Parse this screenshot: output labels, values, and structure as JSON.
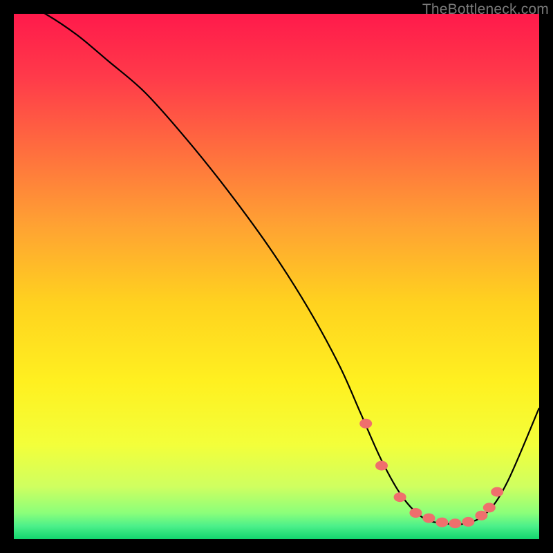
{
  "watermark": "TheBottleneck.com",
  "chart_data": {
    "type": "line",
    "title": "",
    "xlabel": "",
    "ylabel": "",
    "xlim": [
      0,
      100
    ],
    "ylim": [
      0,
      100
    ],
    "grid": false,
    "background_gradient": {
      "stops": [
        {
          "offset": 0.0,
          "color": "#ff1a4b"
        },
        {
          "offset": 0.12,
          "color": "#ff3a4a"
        },
        {
          "offset": 0.25,
          "color": "#ff6a3f"
        },
        {
          "offset": 0.4,
          "color": "#ffa133"
        },
        {
          "offset": 0.55,
          "color": "#ffd21f"
        },
        {
          "offset": 0.7,
          "color": "#fff020"
        },
        {
          "offset": 0.82,
          "color": "#f3ff3a"
        },
        {
          "offset": 0.9,
          "color": "#cfff60"
        },
        {
          "offset": 0.95,
          "color": "#8bff7a"
        },
        {
          "offset": 0.975,
          "color": "#4cf08a"
        },
        {
          "offset": 1.0,
          "color": "#12d66e"
        }
      ]
    },
    "series": [
      {
        "name": "bottleneck-curve",
        "color": "#000000",
        "x": [
          0,
          6,
          12,
          18,
          25,
          33,
          41,
          49,
          56,
          62,
          66,
          70,
          74,
          78,
          82,
          86,
          90,
          94,
          100
        ],
        "values": [
          103,
          100,
          96,
          91,
          85,
          76,
          66,
          55,
          44,
          33,
          24,
          15,
          8,
          4,
          3,
          3,
          5,
          11,
          25
        ]
      }
    ],
    "markers": {
      "name": "highlight-dots",
      "color": "#ef6f6d",
      "x": [
        67,
        70,
        73.5,
        76.5,
        79,
        81.5,
        84,
        86.5,
        89,
        90.5,
        92
      ],
      "values": [
        22,
        14,
        8,
        5,
        4,
        3.2,
        3,
        3.3,
        4.5,
        6,
        9
      ]
    }
  }
}
